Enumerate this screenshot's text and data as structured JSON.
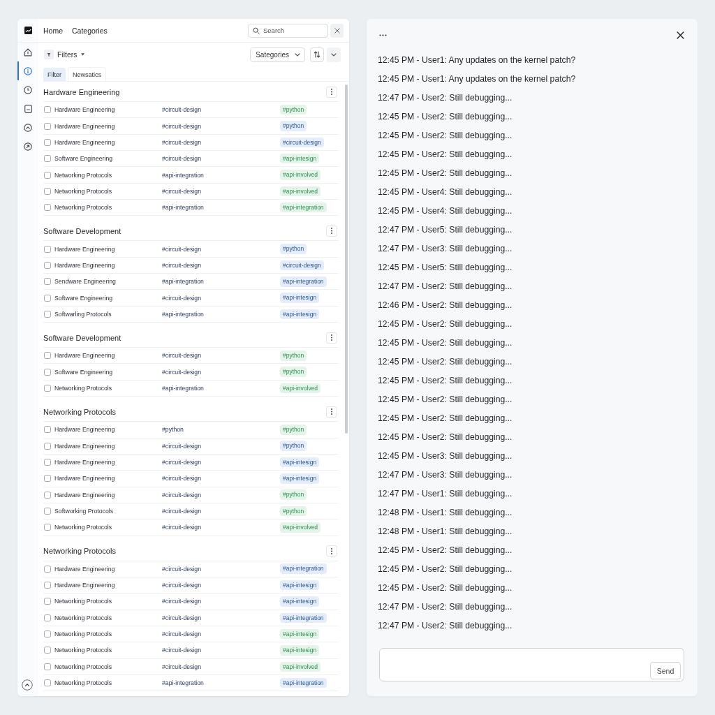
{
  "nav": {
    "links": [
      {
        "label": "Home"
      },
      {
        "label": "Categories"
      }
    ],
    "search": {
      "placeholder": "Search"
    }
  },
  "sidebar": {
    "items": [
      {
        "selected": false
      },
      {
        "selected": true
      },
      {
        "selected": false
      },
      {
        "selected": false
      },
      {
        "selected": false
      },
      {
        "selected": false
      }
    ]
  },
  "toolbar": {
    "filter": "Filters",
    "category": "Sategories"
  },
  "tabs": [
    {
      "label": "Filter",
      "selected": true
    },
    {
      "label": "Newsatics",
      "selected": false
    }
  ],
  "sections": [
    {
      "title": "Hardware Engineering",
      "rows": [
        {
          "checked": false,
          "name": "Hardware Engineering",
          "hashtag": "#circuit-design",
          "tag": "#python",
          "color": "#e5f4ea"
        },
        {
          "checked": false,
          "name": "Hardware Engineering",
          "hashtag": "#circuit-design",
          "tag": "#python",
          "color": "#e4edf9"
        },
        {
          "checked": false,
          "name": "Hardware Engineering",
          "hashtag": "#circuit-design",
          "tag": "#circuit-design",
          "color": "#e4edf9"
        },
        {
          "checked": false,
          "name": "Software Engineering",
          "hashtag": "#circuit-design",
          "tag": "#api-intesign",
          "color": "#e5f4ea"
        },
        {
          "checked": false,
          "name": "Networking Protocols",
          "hashtag": "#api-integration",
          "tag": "#api-involved",
          "color": "#e5f4ea"
        },
        {
          "checked": false,
          "name": "Networking Protocols",
          "hashtag": "#circuit-design",
          "tag": "#api-involved",
          "color": "#e5f4ea"
        },
        {
          "checked": false,
          "name": "Networking Protocols",
          "hashtag": "#api-integration",
          "tag": "#api-integration",
          "color": "#e5f4ea"
        }
      ]
    },
    {
      "title": "Software Development",
      "rows": [
        {
          "checked": false,
          "name": "Hardware Engineering",
          "hashtag": "#circuit-design",
          "tag": "#python",
          "color": "#e4edf9"
        },
        {
          "checked": false,
          "name": "Hardware Engineering",
          "hashtag": "#circuit-design",
          "tag": "#circuit-design",
          "color": "#e4edf9"
        },
        {
          "checked": false,
          "name": "Sendware Engineering",
          "hashtag": "#api-integration",
          "tag": "#api-integration",
          "color": "#e4edf9"
        },
        {
          "checked": false,
          "name": "Software Engineering",
          "hashtag": "#circuit-design",
          "tag": "#api-intesign",
          "color": "#e4edf9"
        },
        {
          "checked": false,
          "name": "Softwarling Protocols",
          "hashtag": "#api-integration",
          "tag": "#api-intesign",
          "color": "#e4edf9"
        }
      ]
    },
    {
      "title": "Software Development",
      "rows": [
        {
          "checked": false,
          "name": "Hardware Engineering",
          "hashtag": "#circuit-design",
          "tag": "#python",
          "color": "#e5f4ea"
        },
        {
          "checked": false,
          "name": "Software Engineering",
          "hashtag": "#circuit-design",
          "tag": "#python",
          "color": "#e5f4ea"
        },
        {
          "checked": false,
          "name": "Networking Protocols",
          "hashtag": "#api-integration",
          "tag": "#api-involved",
          "color": "#e5f4ea"
        }
      ]
    },
    {
      "title": "Networking Protocols",
      "rows": [
        {
          "checked": false,
          "name": "Hardware Engineering",
          "hashtag": "#python",
          "tag": "#python",
          "color": "#e5f4ea"
        },
        {
          "checked": false,
          "name": "Hardware Engineering",
          "hashtag": "#circuit-design",
          "tag": "#python",
          "color": "#e4edf9"
        },
        {
          "checked": false,
          "name": "Hardware Engineering",
          "hashtag": "#circuit-design",
          "tag": "#api-intesign",
          "color": "#e4edf9"
        },
        {
          "checked": false,
          "name": "Hardware Engineering",
          "hashtag": "#circuit-design",
          "tag": "#api-intesign",
          "color": "#e4edf9"
        },
        {
          "checked": false,
          "name": "Hardware Engineering",
          "hashtag": "#circuit-design",
          "tag": "#python",
          "color": "#e5f4ea"
        },
        {
          "checked": false,
          "name": "Softworking Protocols",
          "hashtag": "#circuit-design",
          "tag": "#python",
          "color": "#e5f4ea"
        },
        {
          "checked": false,
          "name": "Networking Protocols",
          "hashtag": "#circuit-design",
          "tag": "#api-involved",
          "color": "#e5f4ea"
        }
      ]
    },
    {
      "title": "Networking Protocols",
      "rows": [
        {
          "checked": false,
          "name": "Hardware Engineering",
          "hashtag": "#circuit-design",
          "tag": "#api-integration",
          "color": "#e4edf9"
        },
        {
          "checked": false,
          "name": "Hardware Engineering",
          "hashtag": "#circuit-design",
          "tag": "#api-intesign",
          "color": "#e4edf9"
        },
        {
          "checked": false,
          "name": "Networking Protocols",
          "hashtag": "#circuit-design",
          "tag": "#api-intesign",
          "color": "#e4edf9"
        },
        {
          "checked": false,
          "name": "Networking Protocols",
          "hashtag": "#circuit-design",
          "tag": "#api-integration",
          "color": "#e4edf9"
        },
        {
          "checked": false,
          "name": "Networking Protocols",
          "hashtag": "#circuit-design",
          "tag": "#api-intesign",
          "color": "#e5f4ea"
        },
        {
          "checked": false,
          "name": "Networking Protocols",
          "hashtag": "#circuit-design",
          "tag": "#api-intesign",
          "color": "#e5f4ea"
        },
        {
          "checked": false,
          "name": "Networking Protocols",
          "hashtag": "#circuit-design",
          "tag": "#api-involved",
          "color": "#e5f4ea"
        },
        {
          "checked": false,
          "name": "Networking Protocols",
          "hashtag": "#api-integration",
          "tag": "#api-integration",
          "color": "#e4edf9"
        }
      ]
    }
  ],
  "chat": {
    "messages": [
      "12:45 PM - User1: Any updates on the kernel patch?",
      "12:45 PM - User1: Any updates on the kernel patch?",
      "12:47 PM - User2: Still debugging...",
      "12:45 PM - User2: Still debugging...",
      "12:45 PM - User2: Still debugging...",
      "12:45 PM - User2: Still debugging...",
      "12:45 PM - User2: Still debugging...",
      "12:45 PM - User4: Still debugging...",
      "12:45 PM - User4: Still debugging...",
      "12:47 PM - User5: Still debugging...",
      "12:47 PM - User3: Still debugging...",
      "12:45 PM - User5: Still debugging...",
      "12:47 PM - User2: Still debugging...",
      "12:46 PM - User2: Still debugging...",
      "12:45 PM - User2: Still debugging...",
      "12:45 PM - User2: Still debugging...",
      "12:45 PM - User2: Still debugging...",
      "12:45 PM - User2: Still debugging...",
      "12:45 PM - User2: Still debugging...",
      "12:45 PM - User2: Still debugging...",
      "12:45 PM - User2: Still debugging...",
      "12:45 PM - User3: Still debugging...",
      "12:47 PM - User3: Still debugging...",
      "12:47 PM - User1: Still debugging...",
      "12:48 PM - User1: Still debugging...",
      "12:48 PM - User1: Still debugging...",
      "12:45 PM - User2: Still debugging...",
      "12:45 PM - User2: Still debugging...",
      "12:45 PM - User2: Still debugging...",
      "12:47 PM - User2: Still debugging...",
      "12:47 PM - User2: Still debugging..."
    ],
    "composer": {
      "button": "Send"
    }
  }
}
